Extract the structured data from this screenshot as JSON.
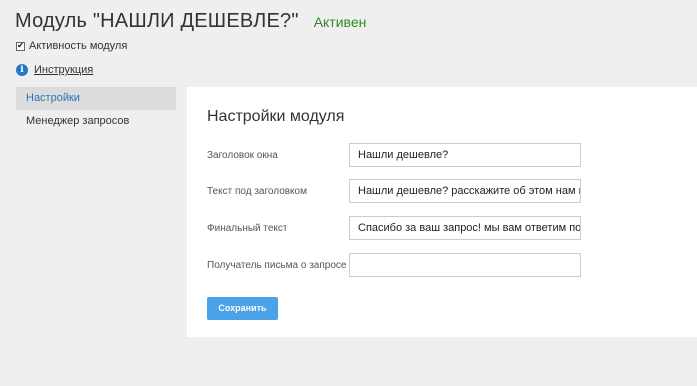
{
  "header": {
    "title": "Модуль \"НАШЛИ ДЕШЕВЛЕ?\"",
    "status": "Активен",
    "status_color": "#2f8a25"
  },
  "activity": {
    "label": "Активность модуля",
    "checked": true,
    "check_glyph": "✔"
  },
  "instruction": {
    "icon": "info-icon",
    "icon_glyph": "i",
    "link": "Инструкция"
  },
  "sidebar": {
    "items": [
      {
        "label": "Настройки",
        "active": true
      },
      {
        "label": "Менеджер запросов",
        "active": false
      }
    ]
  },
  "panel": {
    "title": "Настройки модуля",
    "fields": [
      {
        "label": "Заголовок окна",
        "value": "Нашли дешевле?"
      },
      {
        "label": "Текст под заголовком",
        "value": "Нашли дешевле? расскажите об этом нам и мы"
      },
      {
        "label": "Финальный текст",
        "value": "Спасибо за ваш запрос! мы вам ответим потом"
      },
      {
        "label": "Получатель письма о запросе",
        "value": ""
      }
    ],
    "save_label": "Сохранить"
  },
  "colors": {
    "accent": "#4aa3e8",
    "link_active": "#2a74b8",
    "background": "#efefef"
  }
}
